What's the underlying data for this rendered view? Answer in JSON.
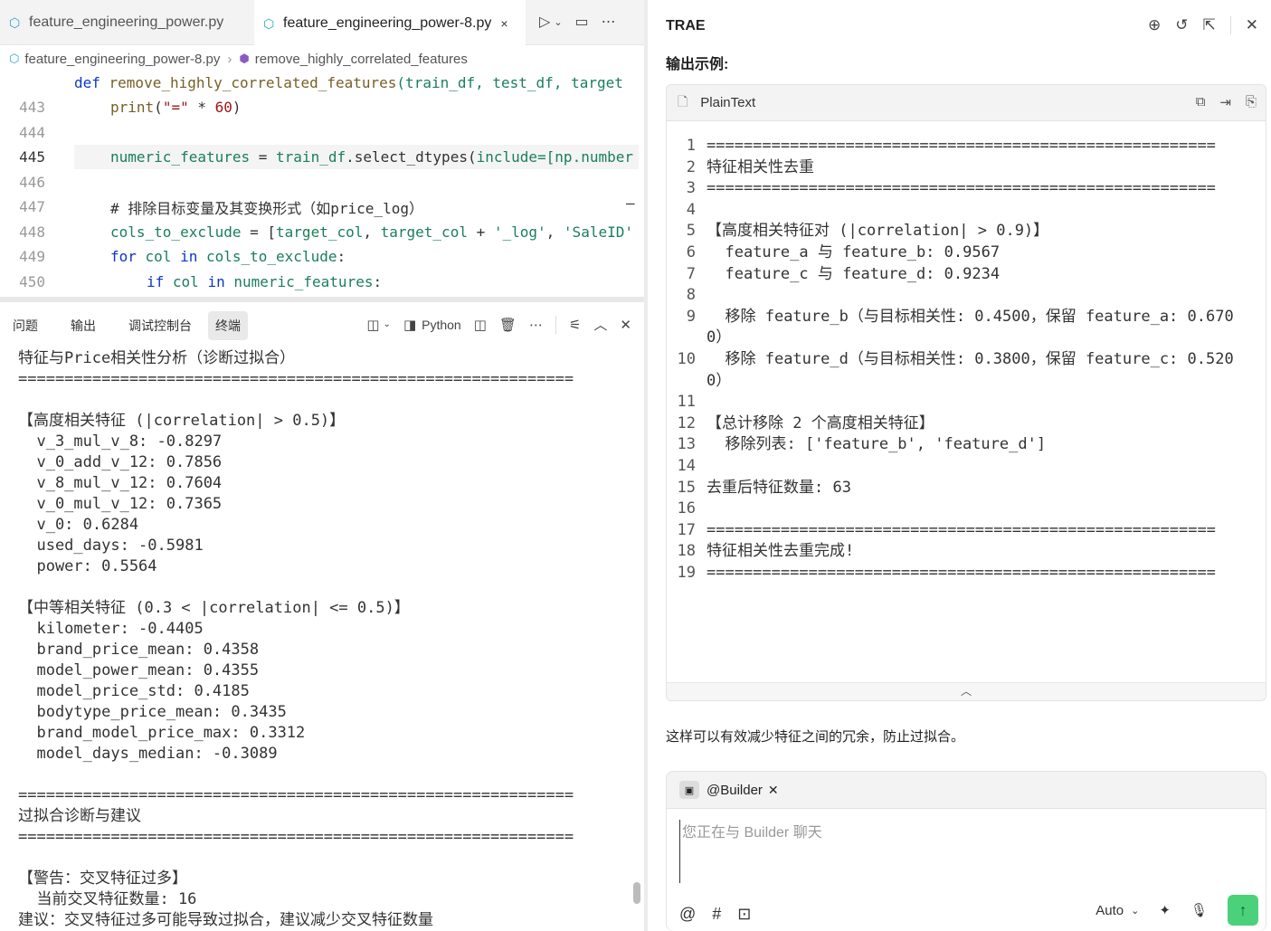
{
  "editor": {
    "tabs": [
      {
        "label": "feature_engineering_power.py"
      },
      {
        "label": "feature_engineering_power-8.py",
        "close": "×"
      }
    ],
    "breadcrumb": {
      "file": "feature_engineering_power-8.py",
      "symbol": "remove_highly_correlated_features"
    },
    "code": {
      "sticky_def": {
        "def": "def ",
        "name": "remove_highly_correlated_features",
        "args": "(train_df, test_df, target"
      },
      "lines": [
        {
          "n": "443"
        },
        {
          "n": "444"
        },
        {
          "n": "445"
        },
        {
          "n": "446"
        },
        {
          "n": "447"
        },
        {
          "n": "448"
        },
        {
          "n": "449"
        },
        {
          "n": "450"
        }
      ],
      "l443": {
        "fn": "print",
        "open": "(",
        "str": "\"=\"",
        "op": " * ",
        "num": "60",
        "close": ")"
      },
      "l445": {
        "var": "numeric_features",
        "op": " = ",
        "obj": "train_df",
        "call": ".select_dtypes(",
        "kw": "include",
        "rest": "=[np.number"
      },
      "l447": {
        "comment": "# 排除目标变量及其变换形式（如price_log）"
      },
      "l448": {
        "var": "cols_to_exclude",
        "op": " = [",
        "a": "target_col",
        "b": ", ",
        "c": "target_col",
        "d": " + ",
        "s1": "'_log'",
        "e": ", ",
        "s2": "'SaleID'"
      },
      "l449": {
        "kw1": "for",
        "v1": " col ",
        "kw2": "in",
        "v2": " cols_to_exclude",
        "end": ":"
      },
      "l450": {
        "kw1": "if",
        "v1": " col ",
        "kw2": "in",
        "v2": " numeric_features",
        "end": ":"
      }
    }
  },
  "panel": {
    "tabs": [
      "问题",
      "输出",
      "调试控制台",
      "终端"
    ],
    "active_tab": "终端",
    "shell_label": "Python",
    "terminal_lines": [
      "特征与Price相关性分析（诊断过拟合）",
      "============================================================",
      "",
      "【高度相关特征 (|correlation| > 0.5)】",
      "  v_3_mul_v_8: -0.8297",
      "  v_0_add_v_12: 0.7856",
      "  v_8_mul_v_12: 0.7604",
      "  v_0_mul_v_12: 0.7365",
      "  v_0: 0.6284",
      "  used_days: -0.5981",
      "  power: 0.5564",
      "",
      "【中等相关特征 (0.3 < |correlation| <= 0.5)】",
      "  kilometer: -0.4405",
      "  brand_price_mean: 0.4358",
      "  model_power_mean: 0.4355",
      "  model_price_std: 0.4185",
      "  bodytype_price_mean: 0.3435",
      "  brand_model_price_max: 0.3312",
      "  model_days_median: -0.3089",
      "",
      "============================================================",
      "过拟合诊断与建议",
      "============================================================",
      "",
      "【警告：交叉特征过多】",
      "  当前交叉特征数量: 16",
      "建议：交叉特征过多可能导致过拟合，建议减少交叉特征数量"
    ]
  },
  "assistant": {
    "title": "TRAE",
    "output_heading": "输出示例:",
    "codeblock": {
      "lang": "PlainText",
      "lines": [
        {
          "n": "1",
          "t": "======================================================="
        },
        {
          "n": "2",
          "t": "特征相关性去重"
        },
        {
          "n": "3",
          "t": "======================================================="
        },
        {
          "n": "4",
          "t": ""
        },
        {
          "n": "5",
          "t": "【高度相关特征对 (|correlation| > 0.9)】"
        },
        {
          "n": "6",
          "t": "  feature_a 与 feature_b: 0.9567"
        },
        {
          "n": "7",
          "t": "  feature_c 与 feature_d: 0.9234"
        },
        {
          "n": "8",
          "t": ""
        },
        {
          "n": "9",
          "t": "  移除 feature_b（与目标相关性: 0.4500，保留 feature_a: 0.6700）"
        },
        {
          "n": "10",
          "t": "  移除 feature_d（与目标相关性: 0.3800，保留 feature_c: 0.5200）"
        },
        {
          "n": "11",
          "t": ""
        },
        {
          "n": "12",
          "t": "【总计移除 2 个高度相关特征】"
        },
        {
          "n": "13",
          "t": "  移除列表: ['feature_b', 'feature_d']"
        },
        {
          "n": "14",
          "t": ""
        },
        {
          "n": "15",
          "t": "去重后特征数量: 63"
        },
        {
          "n": "16",
          "t": ""
        },
        {
          "n": "17",
          "t": "======================================================="
        },
        {
          "n": "18",
          "t": "特征相关性去重完成!"
        },
        {
          "n": "19",
          "t": "======================================================="
        }
      ]
    },
    "summary": "这样可以有效减少特征之间的冗余，防止过拟合。",
    "chat": {
      "agent": "@Builder",
      "placeholder": "您正在与 Builder 聊天",
      "model": "Auto"
    }
  },
  "colors": {
    "accent_send": "#4cd17b",
    "keyword": "#0b37c7",
    "variable": "#1a7f5a",
    "string": "#a31515"
  }
}
